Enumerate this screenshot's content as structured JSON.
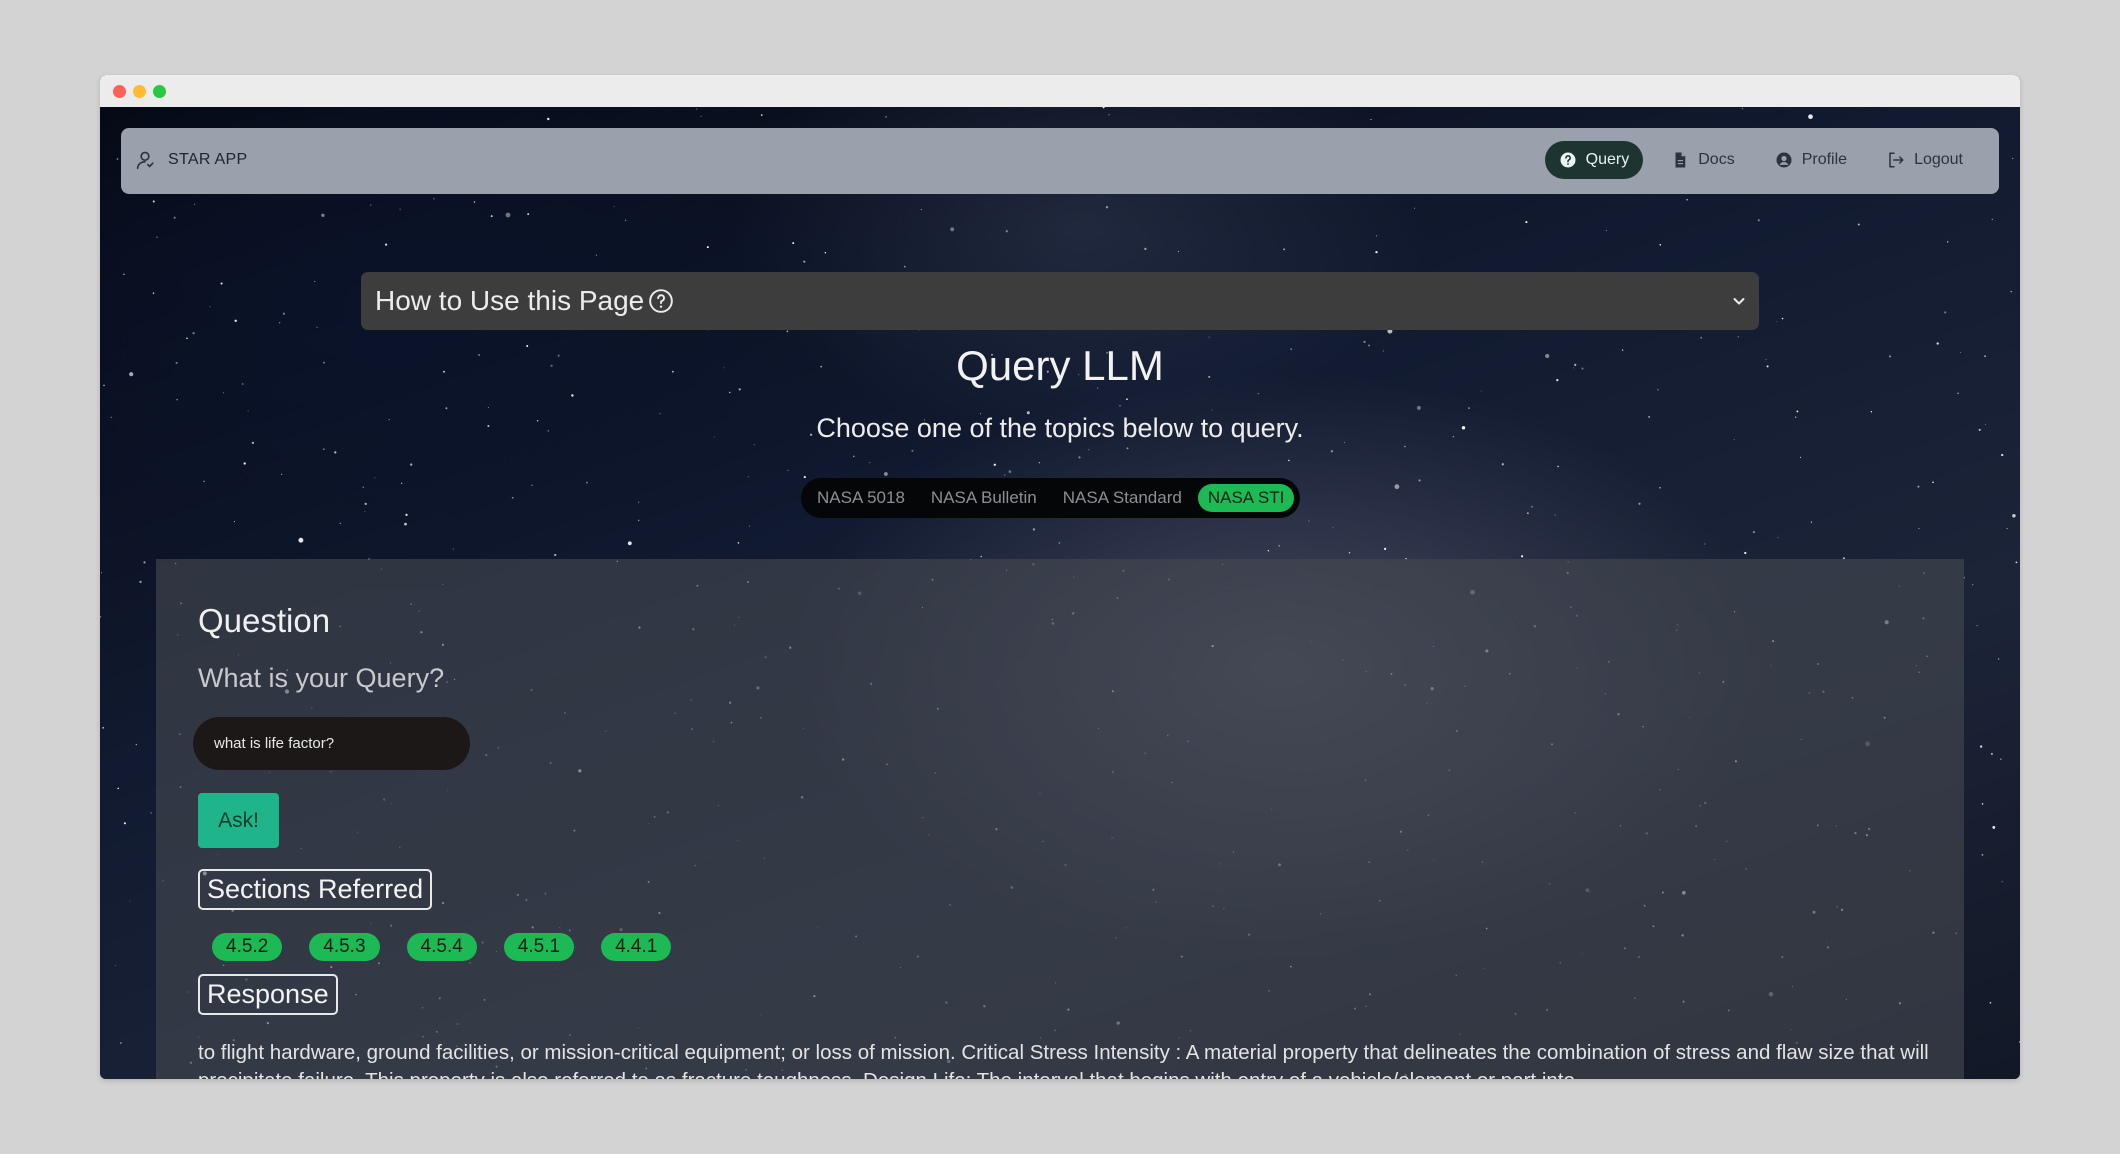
{
  "navbar": {
    "brand": "STAR APP",
    "items": [
      {
        "label": "Query",
        "icon": "question-circle-icon",
        "active": true
      },
      {
        "label": "Docs",
        "icon": "document-icon",
        "active": false
      },
      {
        "label": "Profile",
        "icon": "user-circle-icon",
        "active": false
      },
      {
        "label": "Logout",
        "icon": "logout-icon",
        "active": false
      }
    ]
  },
  "accordion": {
    "title": "How to Use this Page"
  },
  "page": {
    "title": "Query LLM",
    "subtitle": "Choose one of the topics below to query."
  },
  "topics": [
    {
      "label": "NASA 5018",
      "active": false
    },
    {
      "label": "NASA Bulletin",
      "active": false
    },
    {
      "label": "NASA Standard",
      "active": false
    },
    {
      "label": "NASA STI",
      "active": true
    }
  ],
  "question": {
    "heading": "Question",
    "prompt": "What is your Query?",
    "input_value": "what is life factor?",
    "ask_label": "Ask!"
  },
  "sections": {
    "label": "Sections Referred",
    "chips": [
      "4.5.2",
      "4.5.3",
      "4.5.4",
      "4.5.1",
      "4.4.1"
    ]
  },
  "response": {
    "label": "Response",
    "text": "to flight hardware, ground facilities, or mission-critical equipment; or loss of mission. Critical Stress Intensity : A material property that delineates the combination of stress and flaw size that will precipitate failure. This property is also referred to as fracture toughness. Design Life: The interval that begins with entry of a vehicle/element or part into"
  },
  "colors": {
    "accent_green": "#1db954",
    "ask_button": "#20b48a",
    "navbar_bg": "#9aa1ad",
    "active_nav_bg": "#1e3430"
  }
}
